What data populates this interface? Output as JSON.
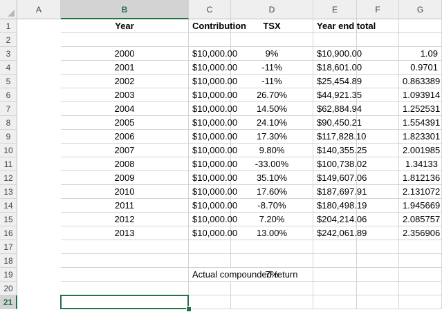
{
  "sheet": {
    "columns": [
      "A",
      "B",
      "C",
      "D",
      "E",
      "F",
      "G"
    ],
    "active_column": "B",
    "active_row": 21,
    "row_numbers": [
      1,
      2,
      3,
      4,
      5,
      6,
      7,
      8,
      9,
      10,
      11,
      12,
      13,
      14,
      15,
      16,
      17,
      18,
      19,
      20,
      21
    ],
    "headers": {
      "year": "Year",
      "contribution": "Contribution",
      "tsx": "TSX",
      "year_end_total": "Year end total"
    },
    "rows": [
      {
        "year": "2000",
        "contribution": "$10,000.00",
        "tsx": "9%",
        "total": "$10,900.00",
        "factor": "1.09"
      },
      {
        "year": "2001",
        "contribution": "$10,000.00",
        "tsx": "-11%",
        "total": "$18,601.00",
        "factor": "0.9701"
      },
      {
        "year": "2002",
        "contribution": "$10,000.00",
        "tsx": "-11%",
        "total": "$25,454.89",
        "factor": "0.863389"
      },
      {
        "year": "2003",
        "contribution": "$10,000.00",
        "tsx": "26.70%",
        "total": "$44,921.35",
        "factor": "1.093914"
      },
      {
        "year": "2004",
        "contribution": "$10,000.00",
        "tsx": "14.50%",
        "total": "$62,884.94",
        "factor": "1.252531"
      },
      {
        "year": "2005",
        "contribution": "$10,000.00",
        "tsx": "24.10%",
        "total": "$90,450.21",
        "factor": "1.554391"
      },
      {
        "year": "2006",
        "contribution": "$10,000.00",
        "tsx": "17.30%",
        "total": "$117,828.10",
        "factor": "1.823301"
      },
      {
        "year": "2007",
        "contribution": "$10,000.00",
        "tsx": "9.80%",
        "total": "$140,355.25",
        "factor": "2.001985"
      },
      {
        "year": "2008",
        "contribution": "$10,000.00",
        "tsx": "-33.00%",
        "total": "$100,738.02",
        "factor": "1.34133"
      },
      {
        "year": "2009",
        "contribution": "$10,000.00",
        "tsx": "35.10%",
        "total": "$149,607.06",
        "factor": "1.812136"
      },
      {
        "year": "2010",
        "contribution": "$10,000.00",
        "tsx": "17.60%",
        "total": "$187,697.91",
        "factor": "2.131072"
      },
      {
        "year": "2011",
        "contribution": "$10,000.00",
        "tsx": "-8.70%",
        "total": "$180,498.19",
        "factor": "1.945669"
      },
      {
        "year": "2012",
        "contribution": "$10,000.00",
        "tsx": "7.20%",
        "total": "$204,214.06",
        "factor": "2.085757"
      },
      {
        "year": "2013",
        "contribution": "$10,000.00",
        "tsx": "13.00%",
        "total": "$242,061.89",
        "factor": "2.356906"
      }
    ],
    "summary": {
      "label": "Actual compounded return",
      "value": "7%"
    },
    "colors": {
      "accent": "#217346",
      "header_bg": "#efefef",
      "gridline": "#d4d4d4"
    }
  }
}
